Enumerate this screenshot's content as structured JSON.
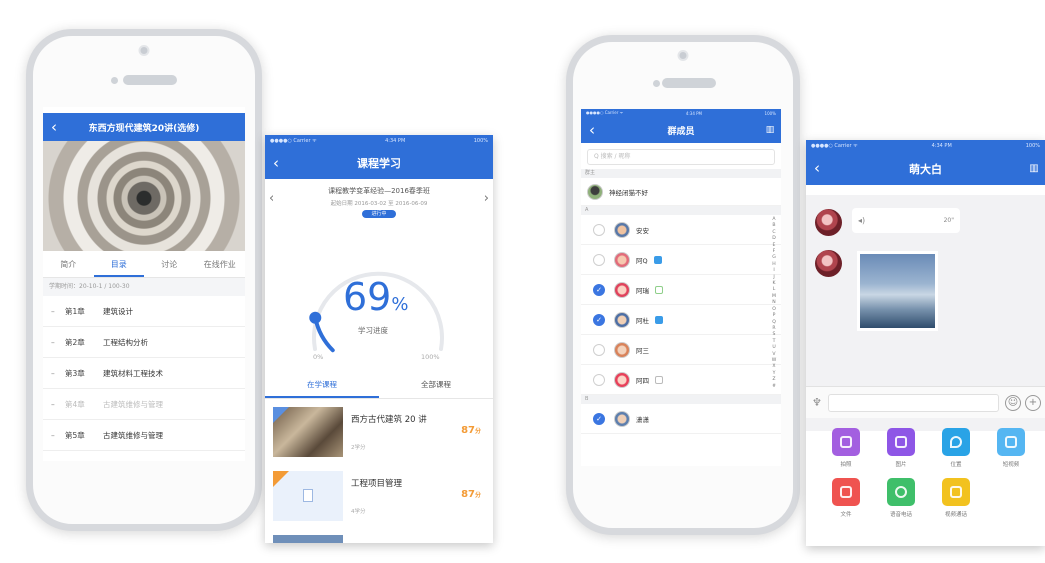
{
  "colors": {
    "brand": "#2f6fd8",
    "accent": "#f39b36",
    "frame": "#d7d9dd"
  },
  "phone1": {
    "title": "东西方现代建筑20讲(选修)",
    "tabs": [
      "简介",
      "目录",
      "讨论",
      "在线作业"
    ],
    "meta": "学期时间：20-10-1 / 100-30",
    "chapters": [
      {
        "num": "第1章",
        "name": "建筑设计",
        "dim": false
      },
      {
        "num": "第2章",
        "name": "工程结构分析",
        "dim": false
      },
      {
        "num": "第3章",
        "name": "建筑材料工程技术",
        "dim": false
      },
      {
        "num": "第4章",
        "name": "古建筑维修与管理",
        "dim": true
      },
      {
        "num": "第5章",
        "name": "古建筑维修与管理",
        "dim": false
      }
    ]
  },
  "card1": {
    "status_left": "●●●●○ Carrier ᯤ",
    "status_mid": "4:34 PM",
    "status_right": "100%",
    "title": "课程学习",
    "back": "‹",
    "subtitle": "课程教学变革经验—2016春季班",
    "date": "起始日期 2016-03-02 至 2016-06-09",
    "badge": "进行中",
    "progress": {
      "value": 69,
      "unit": "%",
      "caption": "学习进度",
      "min_label": "0%",
      "max_label": "100%"
    },
    "tabs": [
      "在学课程",
      "全部课程"
    ],
    "courses": [
      {
        "title": "西方古代建筑 20 讲",
        "sub": "2学分",
        "score": "87",
        "score_unit": "分"
      },
      {
        "title": "工程项目管理",
        "sub": "4学分",
        "score": "87",
        "score_unit": "分"
      }
    ]
  },
  "phone2": {
    "status_left": "●●●●○ Carrier ᯤ",
    "status_mid": "4:34 PM",
    "status_right": "100%",
    "title": "群成员",
    "back": "‹",
    "search_placeholder": "Q 搜索 / 昵称",
    "section_hot": "群主",
    "owner": "神经闭猫不好",
    "section_a": "A",
    "section_b": "B",
    "members": [
      {
        "name": "安安",
        "checked": false,
        "tag": ""
      },
      {
        "name": "阿Q",
        "checked": false,
        "tag": "blue"
      },
      {
        "name": "阿瑞",
        "checked": true,
        "tag": "green"
      },
      {
        "name": "阿杜",
        "checked": true,
        "tag": "blue"
      },
      {
        "name": "阿三",
        "checked": false,
        "tag": ""
      },
      {
        "name": "阿四",
        "checked": false,
        "tag": "gray"
      }
    ],
    "last_member": "潇潇",
    "index_letters": [
      "A",
      "B",
      "C",
      "D",
      "E",
      "F",
      "G",
      "H",
      "I",
      "J",
      "K",
      "L",
      "M",
      "N",
      "O",
      "P",
      "Q",
      "R",
      "S",
      "T",
      "U",
      "V",
      "W",
      "X",
      "Y",
      "Z",
      "#"
    ]
  },
  "card2": {
    "status_left": "●●●●○ Carrier ᯤ",
    "status_mid": "4:34 PM",
    "status_right": "100%",
    "title": "萌大白",
    "back": "‹",
    "voice_duration": "20\"",
    "tools": [
      {
        "label": "拍照",
        "color": "#a35fe0"
      },
      {
        "label": "图片",
        "color": "#8e56e6"
      },
      {
        "label": "位置",
        "color": "#29a3e6"
      },
      {
        "label": "短视频",
        "color": "#55b6f2"
      },
      {
        "label": "文件",
        "color": "#ef5350"
      },
      {
        "label": "语音电话",
        "color": "#3fbf6a"
      },
      {
        "label": "视频通话",
        "color": "#f2c21f"
      }
    ]
  }
}
